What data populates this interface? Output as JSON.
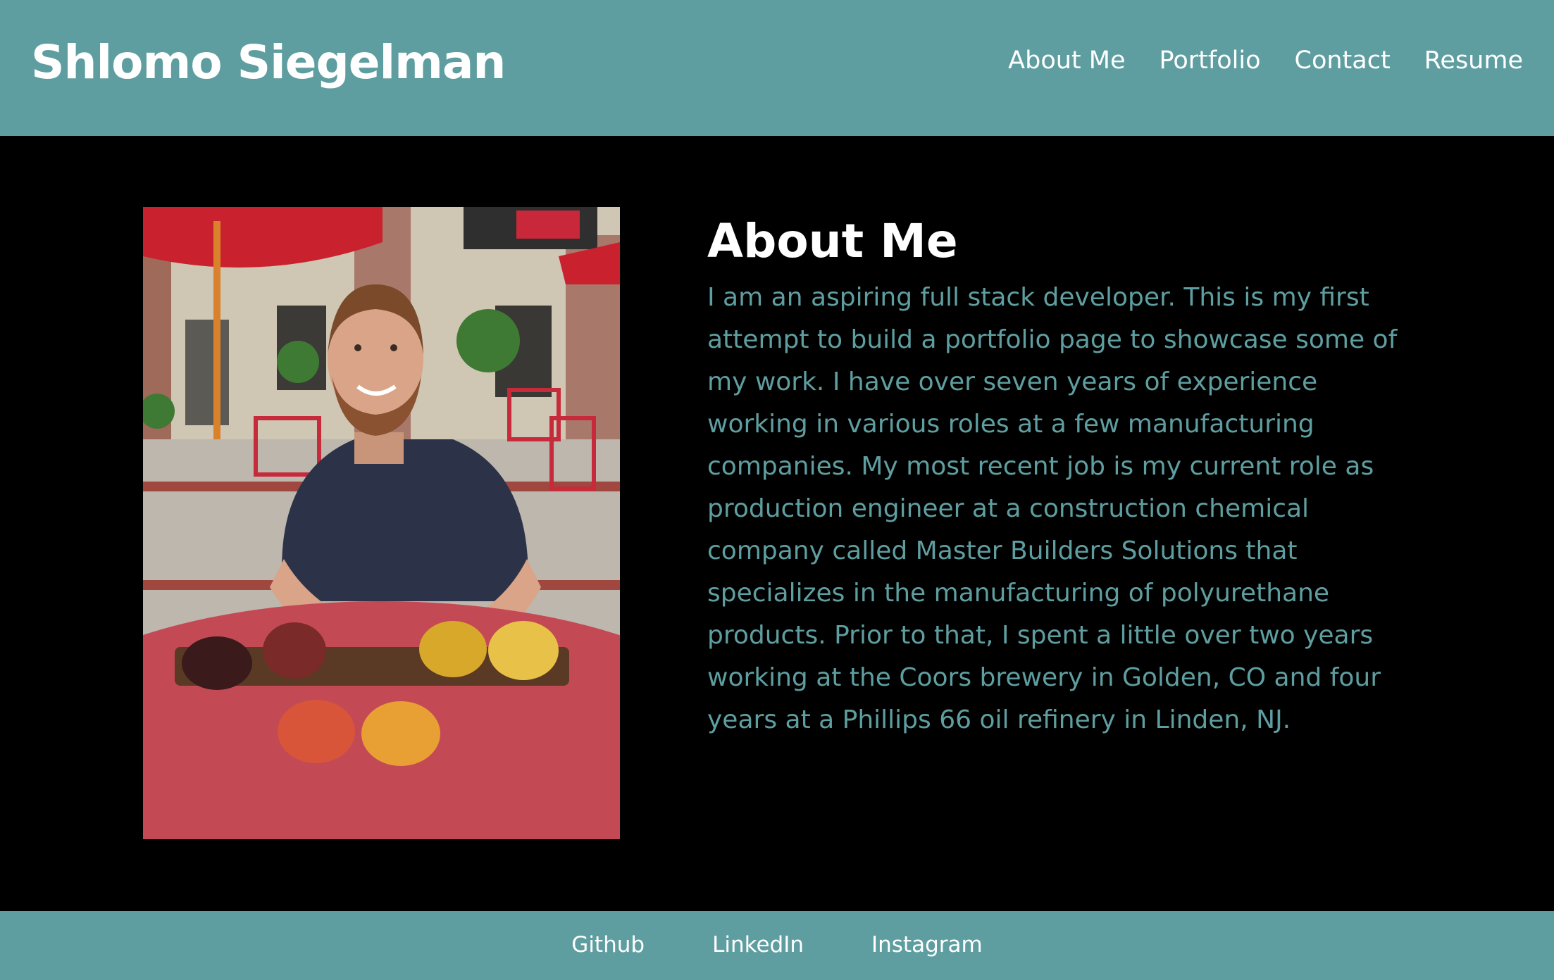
{
  "header": {
    "title": "Shlomo Siegelman",
    "nav": [
      {
        "label": "About Me"
      },
      {
        "label": "Portfolio"
      },
      {
        "label": "Contact"
      },
      {
        "label": "Resume"
      }
    ]
  },
  "about": {
    "heading": "About Me",
    "body": "I am an aspiring full stack developer. This is my first attempt to build a portfolio page to showcase some of my work. I have over seven years of experience working in various roles at a few manufacturing companies. My most recent job is my current role as production engineer at a construction chemical company called Master Builders Solutions that specializes in the manufacturing of polyurethane products. Prior to that, I spent a little over two years working at the Coors brewery in Golden, CO and four years at a Phillips 66 oil refinery in Linden, NJ.",
    "photo": {
      "subject": "man smiling at outdoor patio table with beer flight",
      "icon": "profile-photo"
    }
  },
  "footer": {
    "links": [
      {
        "label": "Github"
      },
      {
        "label": "LinkedIn"
      },
      {
        "label": "Instagram"
      }
    ]
  },
  "colors": {
    "accent": "#5f9ea0",
    "background": "#000000",
    "text_light": "#ffffff"
  }
}
